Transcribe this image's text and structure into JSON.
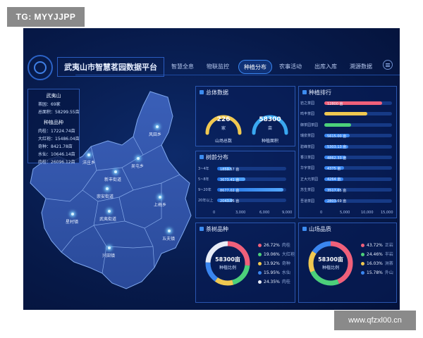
{
  "watermark_top": "TG: MYYJJPP",
  "watermark_bottom": "www.qfzxl00.cn",
  "header": {
    "title": "武夷山市智慧茗园数据平台",
    "nav": [
      "智慧全息",
      "物联监控",
      "种植分布",
      "农事活动",
      "出库入库",
      "溯源数据"
    ],
    "active_nav": "种植分布"
  },
  "info": {
    "region_title": "武夷山",
    "region_lines": [
      "茶园：69家",
      "总面积：58299.55亩"
    ],
    "variety_title": "种植品种",
    "variety_lines": [
      "肉桂：17224.74亩",
      "大红袍：15486.04亩",
      "奇种：8421.78亩",
      "水仙：10646.14亩",
      "肉桂：26096.12亩"
    ]
  },
  "map": {
    "towns": [
      "风田乡",
      "洋庄乡",
      "吴屯乡",
      "新丰街道",
      "崇安街道",
      "上梅乡",
      "武夷街道",
      "星村镇",
      "五夫镇",
      "兴田镇"
    ]
  },
  "overview": {
    "title": "总体数据",
    "farms": {
      "value": "226",
      "unit": "家",
      "label": "山场总数"
    },
    "area": {
      "value": "58300",
      "unit": "亩",
      "label": "种植面积"
    }
  },
  "age_dist": {
    "title": "树龄分布",
    "rows": [
      {
        "label": "3~4年",
        "value": 1859.57,
        "text": "1859.57 亩"
      },
      {
        "label": "5~8年",
        "value": 3673.41,
        "text": "3673.41 亩"
      },
      {
        "label": "9~20年",
        "value": 8677.02,
        "text": "8677.02 亩"
      },
      {
        "label": "20年以上",
        "value": 2043.05,
        "text": "2043.05 亩"
      }
    ],
    "ticks": [
      "0",
      "3,000",
      "6,000",
      "9,000"
    ],
    "max": 9000
  },
  "ranking": {
    "title": "种植排行",
    "rows": [
      {
        "label": "岩之茶园",
        "value": 12800,
        "text": "12800 亩",
        "color": "#f0607a"
      },
      {
        "label": "鸣丰茶园",
        "value": 9500,
        "text": "",
        "color": "#f0c850"
      },
      {
        "label": "御茶园茶园",
        "value": 6000,
        "text": "",
        "color": "#4cd07a"
      },
      {
        "label": "瑞泉茶园",
        "value": 5615,
        "text": "5615.00 亩",
        "color": "#3a86f0"
      },
      {
        "label": "碧峰茶园",
        "value": 5303.13,
        "text": "5303.13 亩",
        "color": "#3a86f0"
      },
      {
        "label": "香江茶园",
        "value": 4862.33,
        "text": "4862.33 亩",
        "color": "#3a86f0"
      },
      {
        "label": "华宇茶园",
        "value": 4375,
        "text": "4375 亩",
        "color": "#3a86f0"
      },
      {
        "label": "正大元茶园",
        "value": 4264,
        "text": "4264 亩",
        "color": "#3a86f0"
      },
      {
        "label": "苏生茶园",
        "value": 3517.65,
        "text": "3517.65 亩",
        "color": "#3a86f0"
      },
      {
        "label": "吾道茶园",
        "value": 2803.69,
        "text": "2803.69 亩",
        "color": "#3a86f0"
      }
    ],
    "ticks": [
      "0",
      "5,000",
      "10,000",
      "15,000"
    ],
    "max": 15000
  },
  "species": {
    "title": "茶树品种",
    "center_value": "58300亩",
    "center_label": "种植比例",
    "slices": [
      {
        "pct": 26.72,
        "text": "26.72%",
        "name": "肉桂",
        "color": "#f0607a"
      },
      {
        "pct": 19.06,
        "text": "19.06%",
        "name": "大红袍",
        "color": "#4cd07a"
      },
      {
        "pct": 13.92,
        "text": "13.92%",
        "name": "奇种",
        "color": "#f0c850"
      },
      {
        "pct": 15.95,
        "text": "15.95%",
        "name": "水仙",
        "color": "#3a86f0"
      },
      {
        "pct": 24.35,
        "text": "24.35%",
        "name": "肉桂",
        "color": "#e8ecf6"
      }
    ]
  },
  "quality": {
    "title": "山场品质",
    "center_value": "58300亩",
    "center_label": "种植比例",
    "slices": [
      {
        "pct": 43.72,
        "text": "43.72%",
        "name": "正岩",
        "color": "#f0607a"
      },
      {
        "pct": 24.46,
        "text": "24.46%",
        "name": "半岩",
        "color": "#4cd07a"
      },
      {
        "pct": 16.03,
        "text": "16.03%",
        "name": "洲茶",
        "color": "#f0c850"
      },
      {
        "pct": 15.78,
        "text": "15.78%",
        "name": "外山",
        "color": "#3a86f0"
      }
    ]
  }
}
